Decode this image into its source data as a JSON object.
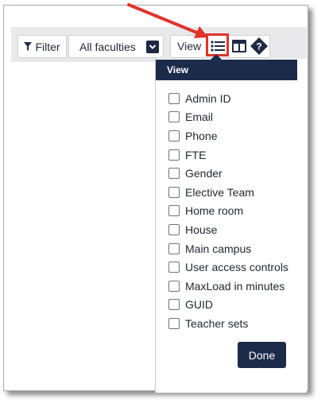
{
  "toolbar": {
    "filter_label": "Filter",
    "faculty_select_value": "All faculties",
    "view_label": "View",
    "icons": {
      "filter": "funnel-icon",
      "select": "chevron-down-icon",
      "list": "list-icon",
      "layout": "table-layout-icon",
      "help": "help-diamond-icon"
    }
  },
  "view_menu": {
    "title": "View",
    "options": [
      {
        "label": "Admin ID",
        "checked": false
      },
      {
        "label": "Email",
        "checked": false
      },
      {
        "label": "Phone",
        "checked": false
      },
      {
        "label": "FTE",
        "checked": false
      },
      {
        "label": "Gender",
        "checked": false
      },
      {
        "label": "Elective Team",
        "checked": false
      },
      {
        "label": "Home room",
        "checked": false
      },
      {
        "label": "House",
        "checked": false
      },
      {
        "label": "Main campus",
        "checked": false
      },
      {
        "label": "User access controls",
        "checked": false
      },
      {
        "label": "MaxLoad in minutes",
        "checked": false
      },
      {
        "label": "GUID",
        "checked": false
      },
      {
        "label": "Teacher sets",
        "checked": false
      }
    ],
    "done_label": "Done"
  },
  "colors": {
    "navy": "#1c2b4a",
    "annotation_red": "#e0342b",
    "toolbar_bg": "#e9e9ec"
  }
}
